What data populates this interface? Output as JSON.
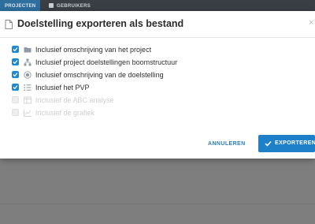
{
  "background": {
    "tabs": [
      {
        "label": "PROJECTEN",
        "active": true
      },
      {
        "label": "GEBRUIKERS",
        "active": false
      }
    ]
  },
  "dialog": {
    "title": "Doelstelling exporteren als bestand",
    "close_symbol": "×",
    "options": [
      {
        "label": "Inclusief omschrijving van het project",
        "checked": true,
        "enabled": true,
        "icon": "folder-icon"
      },
      {
        "label": "Inclusief project doelstellingen boomstructuur",
        "checked": true,
        "enabled": true,
        "icon": "tree-icon"
      },
      {
        "label": "Inclusief omschrijving van de doelstelling",
        "checked": true,
        "enabled": true,
        "icon": "target-icon"
      },
      {
        "label": "Inclusief het PVP",
        "checked": true,
        "enabled": true,
        "icon": "list-icon"
      },
      {
        "label": "Inclusief de ABC analyse",
        "checked": false,
        "enabled": false,
        "icon": "table-icon"
      },
      {
        "label": "Inclusief de grafiek",
        "checked": false,
        "enabled": false,
        "icon": "chart-icon"
      }
    ],
    "cancel_label": "ANNULEREN",
    "export_label": "EXPORTEREN",
    "colors": {
      "accent": "#1e80c8",
      "checkbox": "#1e88d2",
      "disabled_text": "#cfcfcf"
    }
  }
}
